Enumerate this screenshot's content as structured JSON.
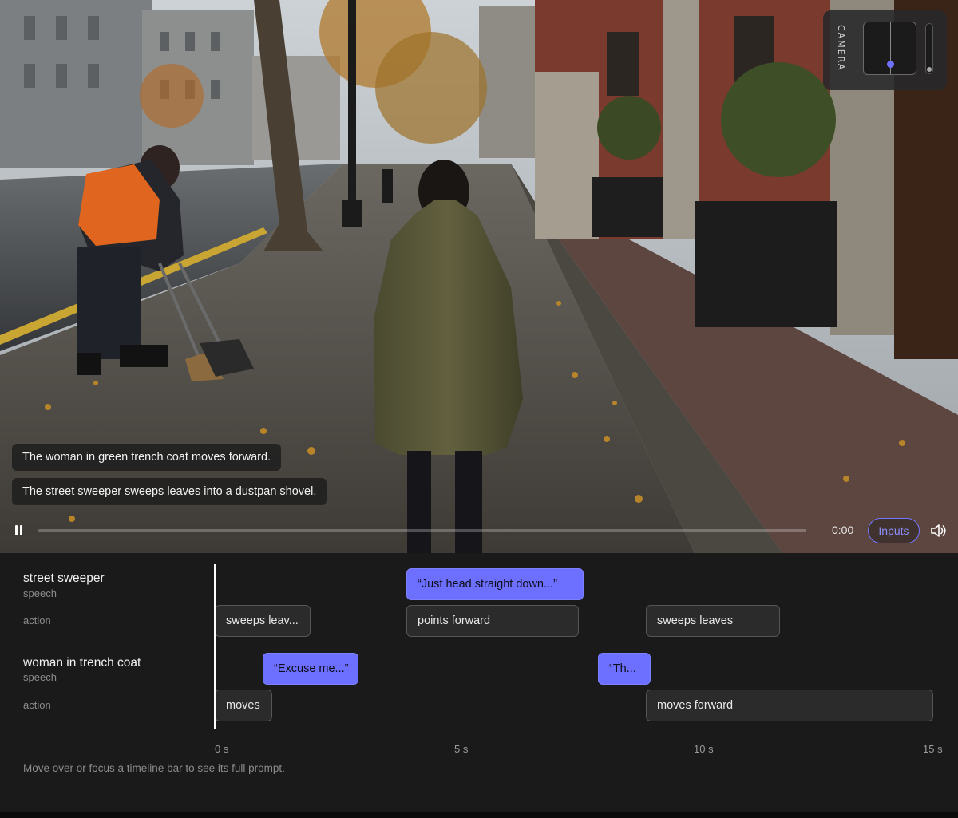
{
  "video": {
    "captions": [
      "The woman in green trench coat moves forward.",
      "The street sweeper sweeps leaves into a dustpan shovel."
    ],
    "camera_label": "CAMERA",
    "controls": {
      "time": "0:00",
      "inputs_label": "Inputs",
      "progress": 0
    }
  },
  "timeline": {
    "tracks": [
      {
        "name": "street sweeper",
        "speech_label": "speech",
        "action_label": "action",
        "speech": [
          {
            "text": "“Just head straight down...”",
            "start": 4.0,
            "end": 7.7
          }
        ],
        "actions": [
          {
            "text": "sweeps leav...",
            "start": 0.0,
            "end": 2.0
          },
          {
            "text": "points forward",
            "start": 4.0,
            "end": 7.6
          },
          {
            "text": "sweeps leaves",
            "start": 9.0,
            "end": 11.8
          }
        ]
      },
      {
        "name": "woman in trench coat",
        "speech_label": "speech",
        "action_label": "action",
        "speech": [
          {
            "text": "“Excuse me...”",
            "start": 1.0,
            "end": 3.0
          },
          {
            "text": "“Th...",
            "start": 8.0,
            "end": 9.1
          }
        ],
        "actions": [
          {
            "text": "moves",
            "start": 0.0,
            "end": 1.2
          },
          {
            "text": "moves forward",
            "start": 9.0,
            "end": 15.0
          }
        ]
      }
    ],
    "ticks": [
      "0 s",
      "5 s",
      "10 s",
      "15 s"
    ],
    "duration": 15,
    "hint": "Move over or focus a timeline bar to see its full prompt."
  },
  "colors": {
    "accent": "#6c6fff",
    "panel": "#1a1a1a",
    "action_bar": "#2b2b2b"
  }
}
